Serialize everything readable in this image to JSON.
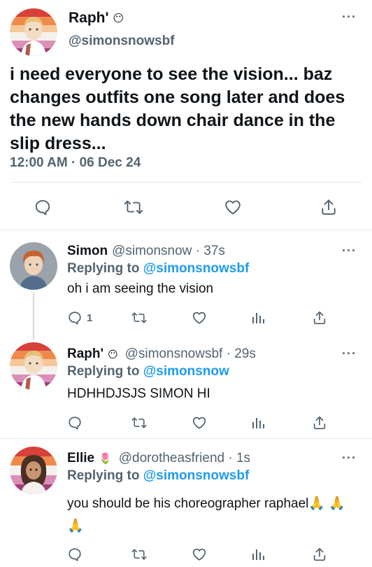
{
  "main_tweet": {
    "display_name": "Raph'",
    "name_emoji": "😶",
    "handle": "@simonsnowsbf",
    "text": "i need everyone to see the vision... baz changes outfits one song later and does the new hands down chair dance in the slip dress...",
    "timestamp": "12:00 AM · 06 Dec 24",
    "more": "···",
    "actions": [
      "reply-icon",
      "retweet-icon",
      "like-icon",
      "share-icon"
    ]
  },
  "replies": [
    {
      "display_name": "Simon",
      "handle_time": "@simonsnow · 37s",
      "replying_label": "Replying to",
      "replying_to": "@simonsnowsbf",
      "text": "oh i am seeing the vision",
      "reply_count": "1",
      "more": "···"
    },
    {
      "display_name": "Raph'",
      "name_emoji": "😶",
      "handle_time": "@simonsnowsbf · 29s",
      "replying_label": "Replying to",
      "replying_to": "@simonsnow",
      "text": "HDHHDJSJS SIMON HI",
      "more": "···"
    },
    {
      "display_name": "Ellie",
      "name_emoji": "🌷",
      "handle_time": "@dorotheasfriend · 1s",
      "replying_label": "Replying to",
      "replying_to": "@simonsnowsbf",
      "text": "you should be his choreographer raphael🙏 🙏 🙏",
      "more": "···"
    }
  ],
  "colors": {
    "text": "#0f1419",
    "secondary": "#536471",
    "link": "#1d9bf0",
    "divider": "#e6e8ea"
  }
}
